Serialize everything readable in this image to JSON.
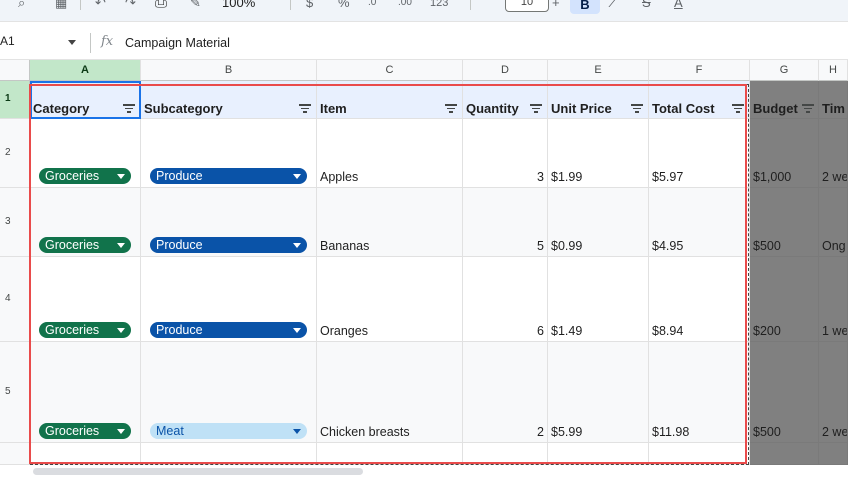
{
  "toolbar": {
    "zoom_label": "100%",
    "font_size": "10",
    "bold_label": "B",
    "text_color_label": "A",
    "strike_label": "S",
    "percent_label": "%",
    "dec_decrease_label": ".0",
    "dec_increase_label": ".00",
    "number_format_label": "123",
    "currency_label": "$"
  },
  "formula_bar": {
    "cell_ref": "A1",
    "fx_label": "fx",
    "formula": "Campaign Material"
  },
  "columns": [
    "A",
    "B",
    "C",
    "D",
    "E",
    "F",
    "G",
    "H"
  ],
  "rows": [
    "1",
    "2",
    "3",
    "4",
    "5"
  ],
  "headers": [
    "Category",
    "Subcategory",
    "Item",
    "Quantity",
    "Unit Price",
    "Total Cost",
    "Budget",
    "Tim"
  ],
  "table": [
    {
      "category": "Groceries",
      "subcategory": "Produce",
      "item": "Apples",
      "quantity": "3",
      "unit_price": "$1.99",
      "total_cost": "$5.97",
      "budget": "$1,000",
      "time": "2 we"
    },
    {
      "category": "Groceries",
      "subcategory": "Produce",
      "item": "Bananas",
      "quantity": "5",
      "unit_price": "$0.99",
      "total_cost": "$4.95",
      "budget": "$500",
      "time": "Ong"
    },
    {
      "category": "Groceries",
      "subcategory": "Produce",
      "item": "Oranges",
      "quantity": "6",
      "unit_price": "$1.49",
      "total_cost": "$8.94",
      "budget": "$200",
      "time": "1 we"
    },
    {
      "category": "Groceries",
      "subcategory": "Meat",
      "item": "Chicken breasts",
      "quantity": "2",
      "unit_price": "$5.99",
      "total_cost": "$11.98",
      "budget": "$500",
      "time": "2 we"
    }
  ],
  "colors": {
    "chip_green": "#11734b",
    "chip_blue": "#0a53a8",
    "chip_light": "#bfe1f6",
    "highlight": "#e94b4b",
    "selection": "#1a73e8"
  }
}
